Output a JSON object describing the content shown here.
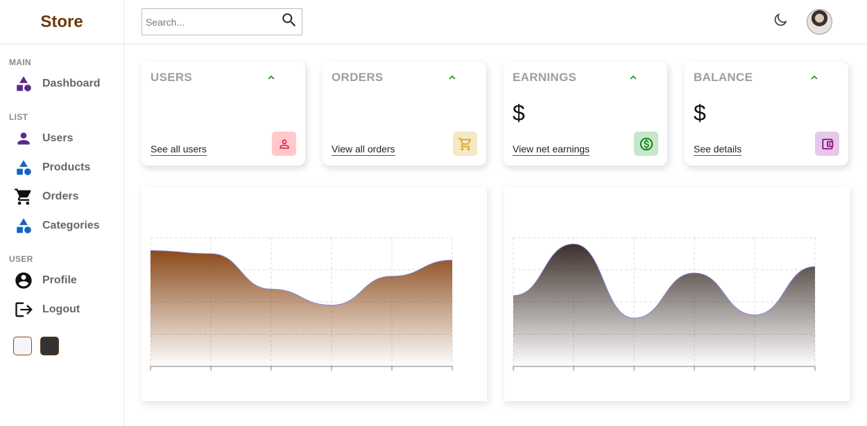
{
  "app": {
    "brand": "Store"
  },
  "sidebar": {
    "sections": [
      {
        "title": "MAIN",
        "items": [
          {
            "label": "Dashboard",
            "icon": "dashboard-icon"
          }
        ]
      },
      {
        "title": "LIST",
        "items": [
          {
            "label": "Users",
            "icon": "person-icon"
          },
          {
            "label": "Products",
            "icon": "category-icon"
          },
          {
            "label": "Orders",
            "icon": "cart-icon"
          },
          {
            "label": "Categories",
            "icon": "category-icon"
          }
        ]
      },
      {
        "title": "USER",
        "items": [
          {
            "label": "Profile",
            "icon": "account-circle-icon"
          },
          {
            "label": "Logout",
            "icon": "logout-icon"
          }
        ]
      }
    ],
    "themes": [
      "light",
      "dark"
    ]
  },
  "topbar": {
    "search_placeholder": "Search...",
    "search_value": ""
  },
  "widgets": [
    {
      "title": "USERS",
      "value": "",
      "link": "See all users",
      "icon": "person-outline-icon",
      "icon_color": "#dc143c",
      "icon_bg": "#ffc9cc"
    },
    {
      "title": "ORDERS",
      "value": "",
      "link": "View all orders",
      "icon": "shopping-cart-icon",
      "icon_color": "#daa520",
      "icon_bg": "#f5e8c4"
    },
    {
      "title": "EARNINGS",
      "value": "$",
      "link": "View net earnings",
      "icon": "dollar-icon",
      "icon_color": "#008000",
      "icon_bg": "#c8e6c9"
    },
    {
      "title": "BALANCE",
      "value": "$",
      "link": "See details",
      "icon": "wallet-icon",
      "icon_color": "#800080",
      "icon_bg": "#e6c9e8"
    }
  ],
  "colors": {
    "brand": "#6b3a0c",
    "chart1_fill": "#8b4a1a",
    "chart2_fill": "#3b2f2a",
    "chart_stroke": "#8884d8",
    "up_arrow": "#008000"
  },
  "chart_data": [
    {
      "type": "area",
      "x": [
        0,
        1,
        2,
        3,
        4,
        5
      ],
      "values": [
        3.6,
        3.5,
        2.4,
        1.9,
        2.8,
        3.3
      ],
      "ylim": [
        0,
        4
      ],
      "grid": true
    },
    {
      "type": "area",
      "x": [
        0,
        1,
        2,
        3,
        4,
        5
      ],
      "values": [
        2.2,
        3.8,
        1.5,
        2.9,
        1.6,
        3.1
      ],
      "ylim": [
        0,
        4
      ],
      "grid": true
    }
  ]
}
